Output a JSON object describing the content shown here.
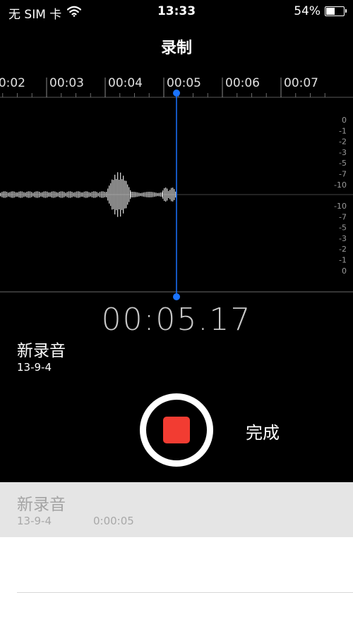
{
  "status_bar": {
    "carrier": "无 SIM 卡",
    "time": "13:33",
    "battery_percent": "54%",
    "battery_level": 0.54,
    "wifi_icon": "wifi-icon",
    "battery_icon": "battery-icon"
  },
  "nav": {
    "title": "录制"
  },
  "timeline": {
    "ticks": [
      "00:02",
      "00:03",
      "00:04",
      "00:05",
      "00:06",
      "00:07"
    ],
    "current_marker": "00:05"
  },
  "level_scale": {
    "upper": [
      "0",
      "-1",
      "-2",
      "-3",
      "-5",
      "-7",
      "-10"
    ],
    "lower": [
      "-10",
      "-7",
      "-5",
      "-3",
      "-2",
      "-1",
      "0"
    ]
  },
  "recorder": {
    "elapsed": "00:05.17",
    "recording_name": "新录音",
    "recording_date": "13-9-4",
    "done_label": "完成",
    "stop_color": "#f23c32",
    "accent_color": "#1a73ff"
  },
  "recordings": [
    {
      "name": "新录音",
      "date": "13-9-4",
      "duration": "0:00:05"
    }
  ]
}
